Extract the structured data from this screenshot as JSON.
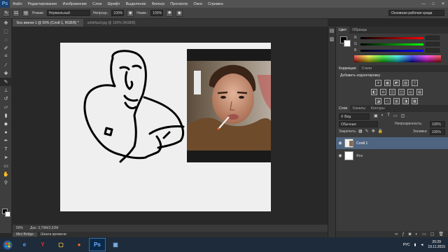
{
  "app": {
    "logo": "Ps"
  },
  "menu": [
    "Файл",
    "Редактирование",
    "Изображение",
    "Слои",
    "Шрифт",
    "Выделение",
    "Фильтр",
    "Просмотр",
    "Окно",
    "Справка"
  ],
  "window_controls": [
    "—",
    "□",
    "✕"
  ],
  "options": {
    "brush_size": "11",
    "mode_label": "Режим:",
    "mode_value": "Нормальный",
    "opacity_label": "Непрозр.:",
    "opacity_value": "100%",
    "pressure_label": "Нажм.:",
    "pressure_value": "100%",
    "workspace": "Основная рабочая среда"
  },
  "doc_tabs": [
    {
      "label": "Без имени-1 @ 50% (Слой 1, RGB/8) *",
      "active": true
    },
    {
      "label": "sddefault.jpg @ 100% (RGB/8)",
      "active": false
    }
  ],
  "status": {
    "zoom": "50%",
    "doc": "Док: 3,79M/3,52M"
  },
  "bridge_tabs": [
    "Mini Bridge",
    "Шкала времени"
  ],
  "color_panel": {
    "tabs": [
      "Цвет",
      "Образцы"
    ],
    "sliders": [
      {
        "label": "R",
        "gradient": "linear-gradient(90deg,#000,#f00)"
      },
      {
        "label": "G",
        "gradient": "linear-gradient(90deg,#000,#0f0)"
      },
      {
        "label": "B",
        "gradient": "linear-gradient(90deg,#000,#00f)"
      }
    ]
  },
  "adjust_panel": {
    "tabs": [
      "Коррекция",
      "Стили"
    ],
    "title": "Добавить корректировку",
    "row1": [
      "☀",
      "▦",
      "◩",
      "▨",
      "▽"
    ],
    "row2": [
      "◧",
      "⚖",
      "◫",
      "◰",
      "◎",
      "▤"
    ],
    "row3": [
      "◪",
      "◇",
      "▥",
      "◨",
      "▩"
    ]
  },
  "layers_panel": {
    "tabs": [
      "Слои",
      "Каналы",
      "Контуры"
    ],
    "filter": "Вид",
    "blend": "Обычные",
    "opacity_label": "Непрозрачность:",
    "opacity_value": "100%",
    "lock_label": "Закрепить:",
    "fill_label": "Заливка:",
    "fill_value": "100%",
    "layers": [
      {
        "name": "Слой 1",
        "selected": true
      },
      {
        "name": "Фон",
        "selected": false
      }
    ]
  },
  "taskbar": {
    "apps": [
      "e",
      "Y",
      "▢",
      "●",
      "Ps",
      "▣"
    ],
    "lang": "РУС",
    "time": "20:29",
    "date": "19.11.2015"
  },
  "colors": {
    "menubar": "#535353",
    "accent": "#1f3f66",
    "selected_layer": "#4e6480"
  }
}
